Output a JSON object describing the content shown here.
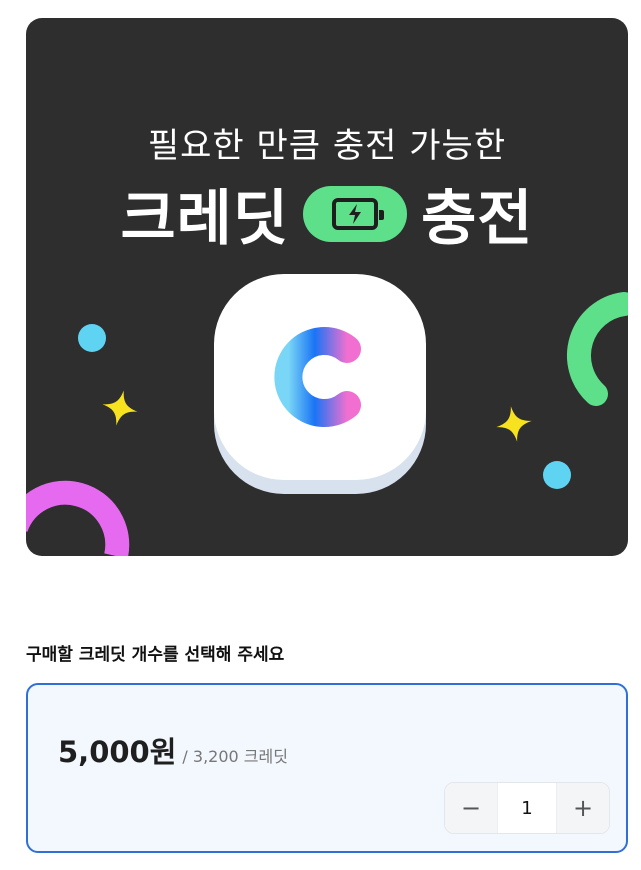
{
  "banner": {
    "subtitle": "필요한 만큼 충전 가능한",
    "title_left": "크레딧",
    "title_right": "충전",
    "icons": [
      "battery-charging-icon",
      "credit-c-logo-icon"
    ],
    "colors": {
      "background": "#2e2e2e",
      "green": "#5ee08a",
      "pink": "#e56af0",
      "yellow": "#f7e21f",
      "cyan": "#5fd4f2",
      "logo_gradient_start": "#7ad6f7",
      "logo_gradient_mid": "#1a74f5",
      "logo_gradient_end": "#f06fd0"
    }
  },
  "section": {
    "title": "구매할 크레딧 개수를 선택해 주세요"
  },
  "option": {
    "price": "5,000원",
    "credit_info": "/ 3,200 크레딧",
    "quantity": "1",
    "minus_label": "−",
    "plus_label": "+",
    "accent_color": "#2f6fd6"
  }
}
